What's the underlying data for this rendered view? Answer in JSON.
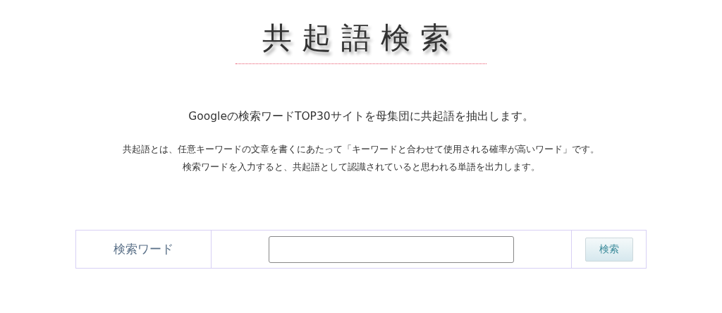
{
  "logo": "共起語検索",
  "headline": "Googleの検索ワードTOP30サイトを母集団に共起語を抽出します。",
  "description": [
    "共起語とは、任意キーワードの文章を書くにあたって「キーワードと合わせて使用される確率が高いワード」です。",
    "検索ワードを入力すると、共起語として認識されていると思われる単語を出力します。"
  ],
  "form": {
    "label": "検索ワード",
    "button": "検索"
  }
}
